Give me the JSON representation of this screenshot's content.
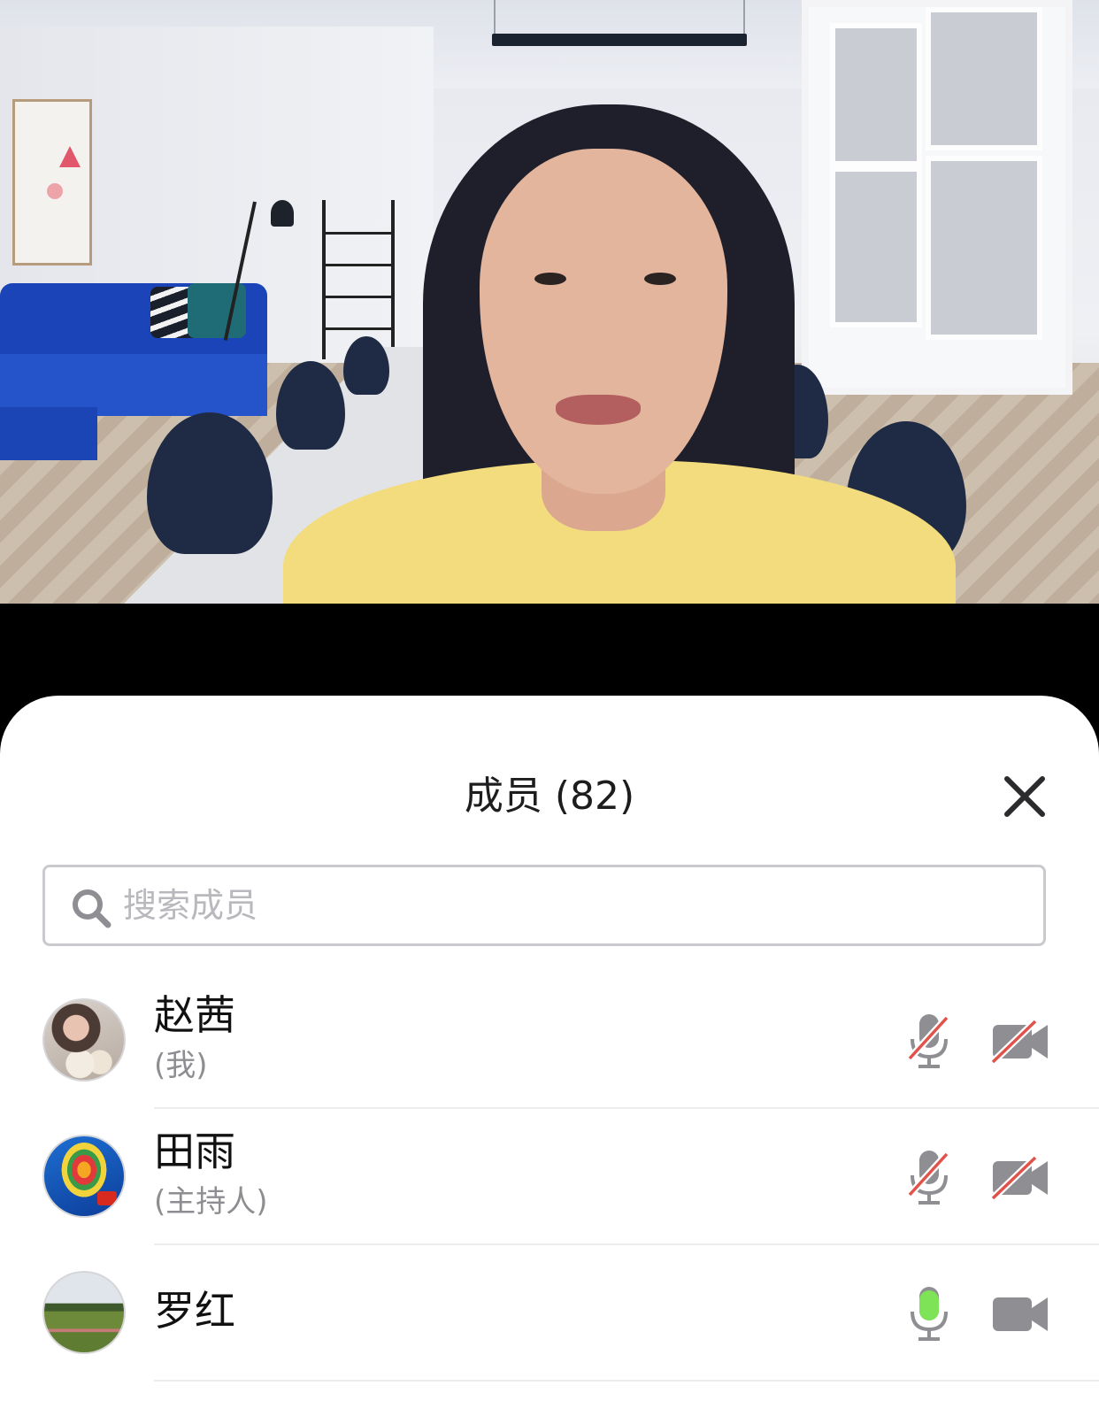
{
  "sheet": {
    "title": "成员 (82)",
    "close_icon": "close-icon"
  },
  "search": {
    "placeholder": "搜索成员",
    "value": "",
    "icon": "search-icon"
  },
  "members": [
    {
      "name": "赵茜",
      "role": "(我)",
      "mic": "muted",
      "camera": "off",
      "avatar": "photo-avatar"
    },
    {
      "name": "田雨",
      "role": "(主持人)",
      "mic": "muted",
      "camera": "off",
      "avatar": "hot-air-balloon-avatar"
    },
    {
      "name": "罗红",
      "role": "",
      "mic": "active",
      "camera": "on",
      "avatar": "field-landscape-avatar"
    }
  ],
  "colors": {
    "muted_slash": "#e0524a",
    "mic_active": "#7ee356",
    "icon_gray": "#8e8e93"
  }
}
